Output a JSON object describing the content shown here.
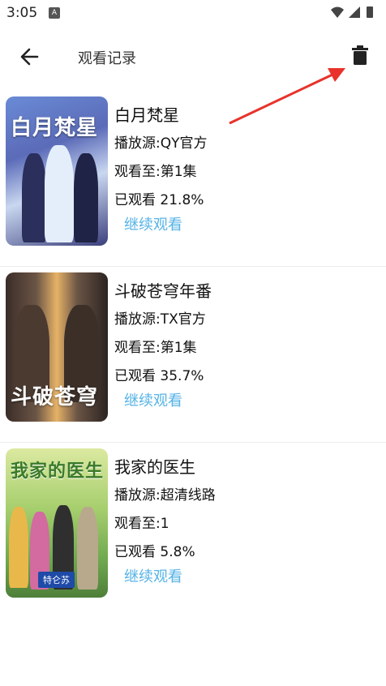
{
  "status_bar": {
    "time": "3:05",
    "notification_icon": "A"
  },
  "header": {
    "title": "观看记录",
    "back_icon": "arrow-left-icon",
    "delete_icon": "trash-icon"
  },
  "history": [
    {
      "title": "白月梵星",
      "poster_title": "白月梵星",
      "source": "播放源:QY官方",
      "episode": "观看至:第1集",
      "progress": "已观看 21.8%",
      "progress_value": 21.8,
      "continue_label": "继续观看"
    },
    {
      "title": "斗破苍穹年番",
      "poster_title": "斗破苍穹",
      "source": "播放源:TX官方",
      "episode": "观看至:第1集",
      "progress": "已观看 35.7%",
      "progress_value": 35.7,
      "continue_label": "继续观看"
    },
    {
      "title": "我家的医生",
      "poster_title": "我家的医生",
      "poster_badge": "特仑苏",
      "source": "播放源:超清线路",
      "episode": "观看至:1",
      "progress": "已观看 5.8%",
      "progress_value": 5.8,
      "continue_label": "继续观看"
    }
  ],
  "colors": {
    "accent": "#56b3e6",
    "annotation_arrow": "#e8322b"
  }
}
